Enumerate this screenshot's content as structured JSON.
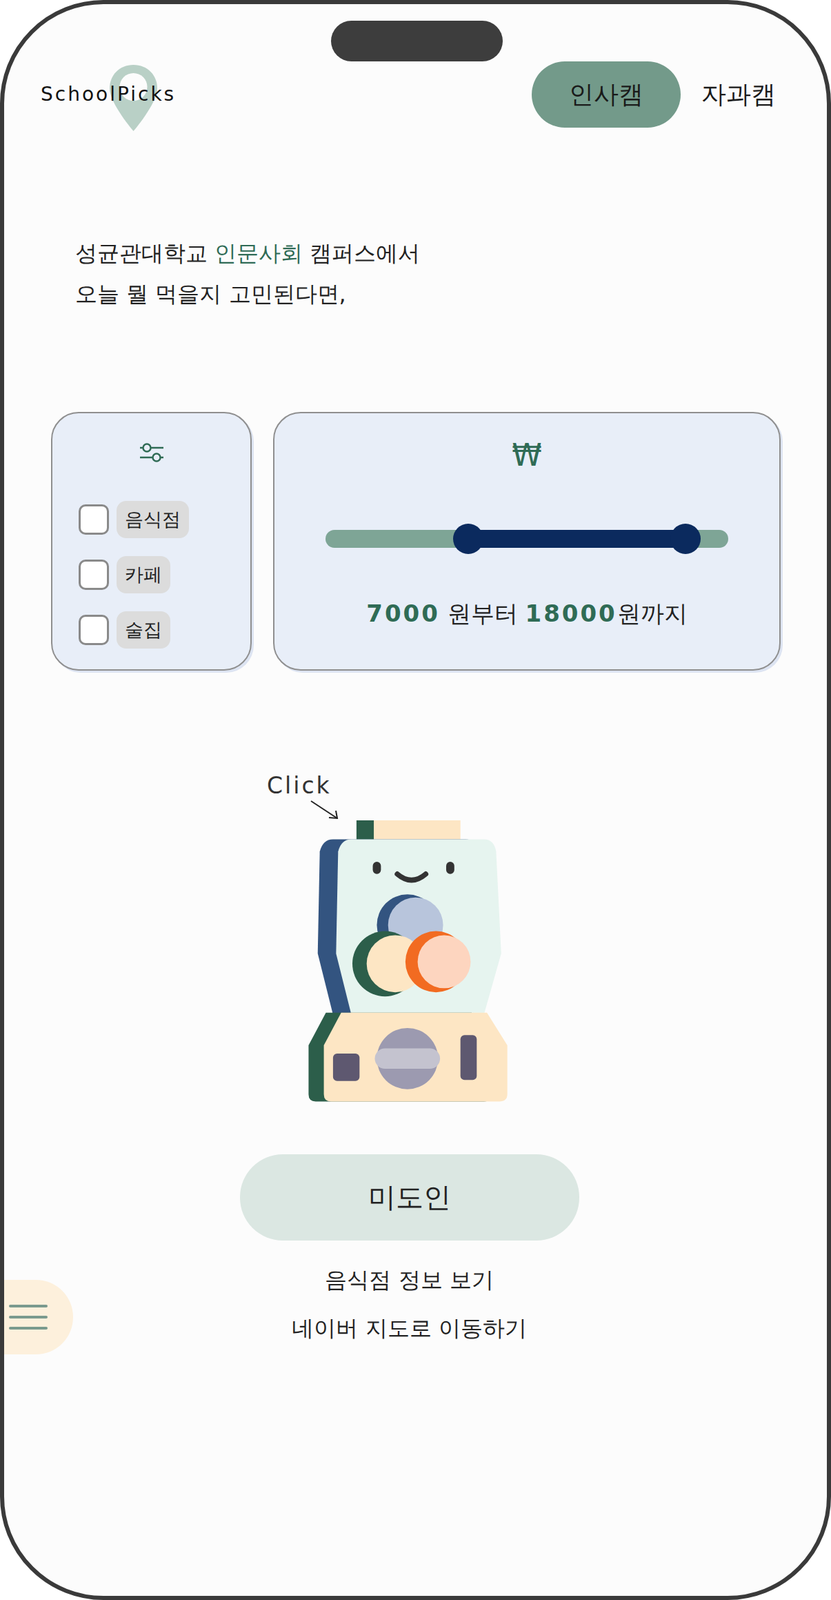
{
  "logo": {
    "text": "SchoolPicks"
  },
  "campus_tabs": [
    {
      "label": "인사캠",
      "selected": true
    },
    {
      "label": "자과캠",
      "selected": false
    }
  ],
  "heading": {
    "prefix": "성균관대학교 ",
    "highlight": "인문사회",
    "suffix": " 캠퍼스에서",
    "line2": "오늘 뭘 먹을지 고민된다면,"
  },
  "filters": [
    {
      "label": "음식점",
      "checked": false
    },
    {
      "label": "카페",
      "checked": false
    },
    {
      "label": "술집",
      "checked": false
    }
  ],
  "price": {
    "currency": "₩",
    "min": "7000",
    "min_suffix": " 원부터 ",
    "max": "18000",
    "max_suffix": "원까지",
    "low": 0.354,
    "high": 0.894
  },
  "gacha": {
    "hint": "Click"
  },
  "result": {
    "name": "미도인"
  },
  "links": [
    "음식점 정보 보기",
    "네이버 지도로 이동하기"
  ]
}
